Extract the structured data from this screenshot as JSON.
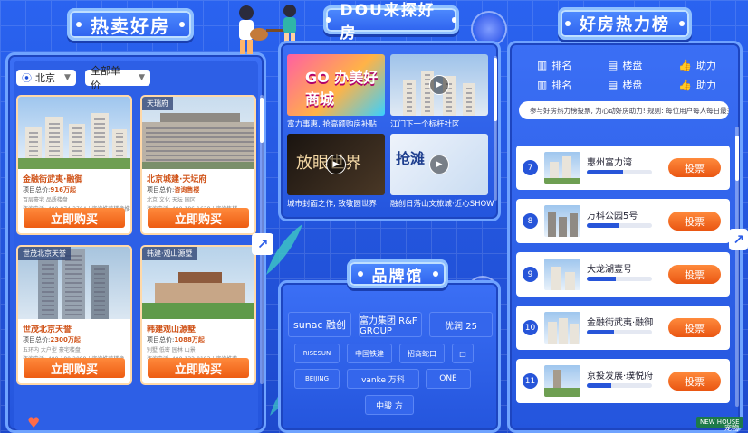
{
  "sections": {
    "hot_sale": "热卖好房",
    "dou": "DOU来探好房",
    "brand": "品牌馆",
    "ranking": "好房热力榜"
  },
  "filters": {
    "city": "北京",
    "price": "全部单价"
  },
  "cards": [
    {
      "img_label": "",
      "name": "金融街武夷·融御",
      "price_prefix": "项目总价:",
      "price": "916万起",
      "line1": "百层豪宅 品质楼盘",
      "line2": "咨询电话: 400-974-3764 | 资询推荐楼盘推荐",
      "buy": "立即购买"
    },
    {
      "img_label": "天瑞府",
      "name": "北京城建·天坛府",
      "price_prefix": "项目总价:",
      "price": "咨询售楼",
      "line1": "北京 文化 天坛 园区",
      "line2": "咨询电话: 400-186-1638 | 资询售楼",
      "buy": "立即购买"
    },
    {
      "img_label": "世茂北京天誉",
      "name": "世茂北京天誉",
      "price_prefix": "项目总价:",
      "price": "2300万起",
      "line1": "五环内 大户型 豪宅楼盘",
      "line2": "咨询电话: 400-180-2088 | 资询推荐楼盘",
      "buy": "立即购买"
    },
    {
      "img_label": "韩建·观山源墅",
      "name": "韩建观山源墅",
      "price_prefix": "项目总价:",
      "price": "1088万起",
      "line1": "别墅 低密 园林 山景",
      "line2": "咨询电话: 400-133-0183 | 资询推荐",
      "buy": "立即购买"
    }
  ],
  "videos": [
    {
      "caption": "富力事惠, 抢高额购房补贴",
      "title": "GO 办美好商城"
    },
    {
      "caption": "江门下一个标杆社区",
      "title": ""
    },
    {
      "caption": "城市封面之作, 致敬圆世界",
      "title": "放眼世界"
    },
    {
      "caption": "融创日落山文旅城·近心SHOW",
      "title": "抢滩"
    }
  ],
  "brands": [
    {
      "name": "sunac 融创"
    },
    {
      "name": "富力集团 R&F GROUP"
    },
    {
      "name": "优润 25"
    },
    {
      "name": "RISESUN"
    },
    {
      "name": "中国铁建"
    },
    {
      "name": "招商蛇口"
    },
    {
      "name": "□"
    },
    {
      "name": "BEIJING"
    },
    {
      "name": "vanke 万科"
    },
    {
      "name": "ONE"
    },
    {
      "name": "中骏 方"
    }
  ],
  "ranking": {
    "headers": [
      "排名",
      "楼盘",
      "助力"
    ],
    "notice": "参与好房热力榜投票, 为心动好房助力! 规则: 每位用户每人每日最多投票5次",
    "vote_label": "投票",
    "rows": [
      {
        "rank": "7",
        "name": "惠州富力湾",
        "progress": 0.55
      },
      {
        "rank": "8",
        "name": "万科公园5号",
        "progress": 0.5
      },
      {
        "rank": "9",
        "name": "大龙湖壹号",
        "progress": 0.45
      },
      {
        "rank": "10",
        "name": "金融街武夷·融御",
        "progress": 0.42
      },
      {
        "rank": "11",
        "name": "京投发展·璞悦府",
        "progress": 0.38
      }
    ]
  },
  "badge": "NEW HOUSE",
  "corner": "宠物"
}
